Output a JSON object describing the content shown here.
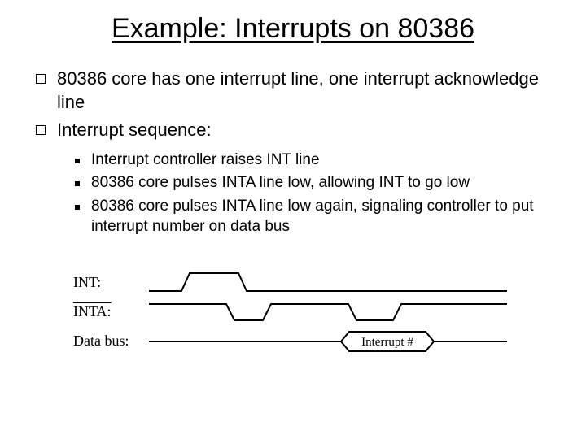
{
  "title": "Example: Interrupts on 80386",
  "bullets": [
    "80386 core has one interrupt line, one interrupt acknowledge line",
    "Interrupt sequence:"
  ],
  "subbullets": [
    "Interrupt controller raises INT line",
    "80386 core pulses INTA line low, allowing INT to go low",
    "80386 core pulses INTA line low again, signaling controller to put interrupt number on data bus"
  ],
  "signals": {
    "int": "INT:",
    "inta": "INTA:",
    "databus": "Data bus:",
    "databus_label": "Interrupt #"
  }
}
